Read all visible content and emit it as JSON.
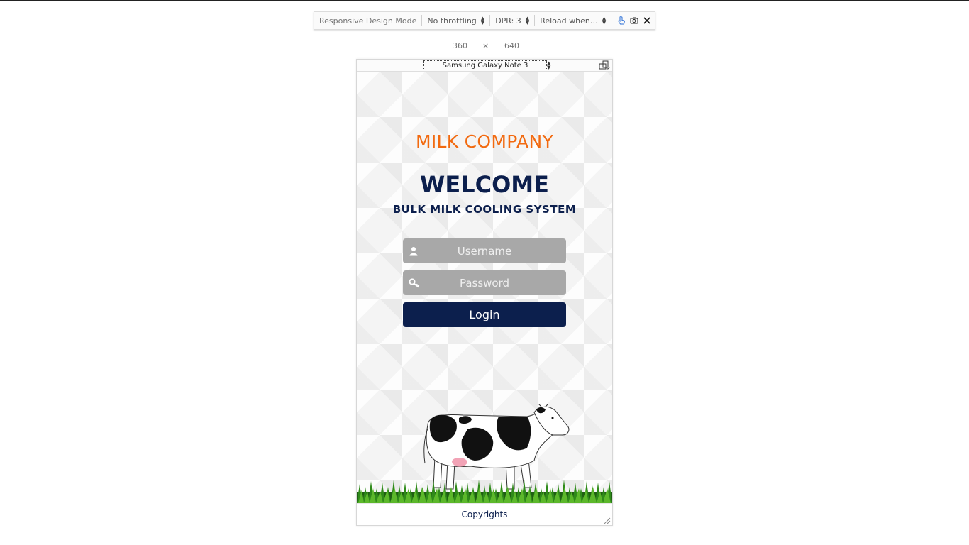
{
  "toolbar": {
    "mode_label": "Responsive Design Mode",
    "throttling": "No throttling",
    "dpr": "DPR: 3",
    "reload": "Reload when…",
    "icons": [
      "touch-simulation-icon",
      "screenshot-icon",
      "close-icon"
    ]
  },
  "viewport_size": {
    "width": "360",
    "times": "×",
    "height": "640"
  },
  "device": {
    "name": "Samsung Galaxy Note 3"
  },
  "page": {
    "brand": "MILK COMPANY",
    "welcome": "WELCOME",
    "subtitle": "BULK MILK COOLING SYSTEM",
    "username_placeholder": "Username",
    "password_placeholder": "Password",
    "login_label": "Login",
    "footer": "Copyrights"
  },
  "colors": {
    "brand": "#f26a10",
    "navy": "#0c1f4d",
    "field_bg": "#a8a8a8"
  }
}
